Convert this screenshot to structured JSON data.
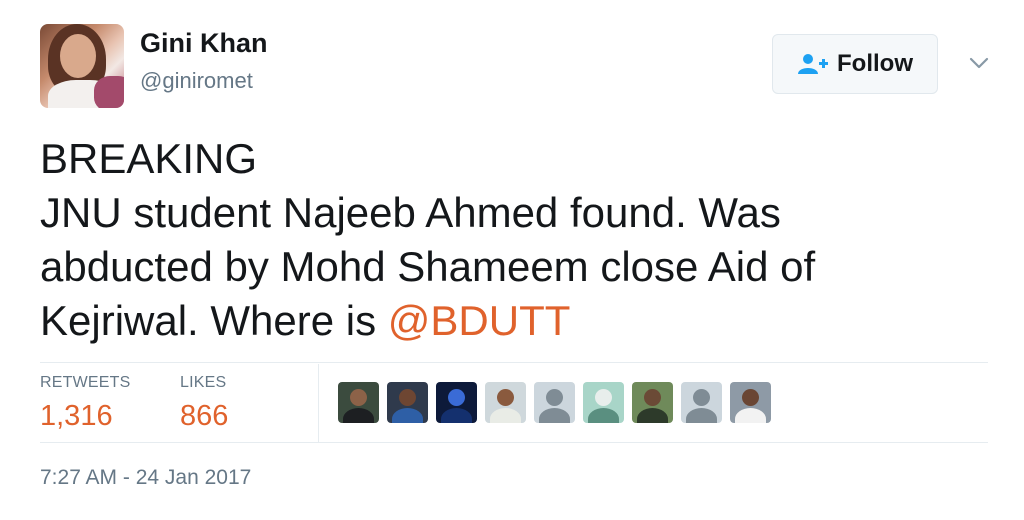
{
  "tweet": {
    "author_name": "Gini Khan",
    "author_handle": "@giniromet",
    "follow_label": "Follow",
    "text_lines": [
      "BREAKING",
      "JNU student Najeeb Ahmed found. Was",
      "abducted by Mohd Shameem close Aid of",
      "Kejriwal. Where is "
    ],
    "mention": "@BDUTT",
    "timestamp": "7:27 AM - 24 Jan 2017"
  },
  "stats": {
    "retweets_label": "RETWEETS",
    "retweets_value": "1,316",
    "likes_label": "LIKES",
    "likes_value": "866"
  },
  "likers": [
    {
      "name": "liker-avatar-1",
      "bg": "#3b4b3e",
      "head": "#8c6248",
      "body": "#1d1f22"
    },
    {
      "name": "liker-avatar-2",
      "bg": "#2f3a4c",
      "head": "#6e4632",
      "body": "#2e5fa6"
    },
    {
      "name": "liker-avatar-3",
      "bg": "#0d1a3a",
      "head": "#3a6bd6",
      "body": "#14306e"
    },
    {
      "name": "liker-avatar-4",
      "bg": "#cfd8dc",
      "head": "#8a5a3e",
      "body": "#e9ece6"
    },
    {
      "name": "liker-avatar-5",
      "bg": "#ccd6dd",
      "head": "#7f8c95",
      "body": "#7f8c95"
    },
    {
      "name": "liker-avatar-6",
      "bg": "#a8d5c8",
      "head": "#e8eeec",
      "body": "#5a8f80"
    },
    {
      "name": "liker-avatar-7",
      "bg": "#6f8a5a",
      "head": "#6b4a36",
      "body": "#2d3a2a"
    },
    {
      "name": "liker-avatar-8",
      "bg": "#ccd6dd",
      "head": "#7f8c95",
      "body": "#7f8c95"
    },
    {
      "name": "liker-avatar-9",
      "bg": "#8e9aa6",
      "head": "#6a4634",
      "body": "#f2f2f2"
    }
  ],
  "colors": {
    "accent": "#e0622c",
    "text": "#14171a",
    "muted": "#657786",
    "follow_icon": "#1da1f2"
  }
}
